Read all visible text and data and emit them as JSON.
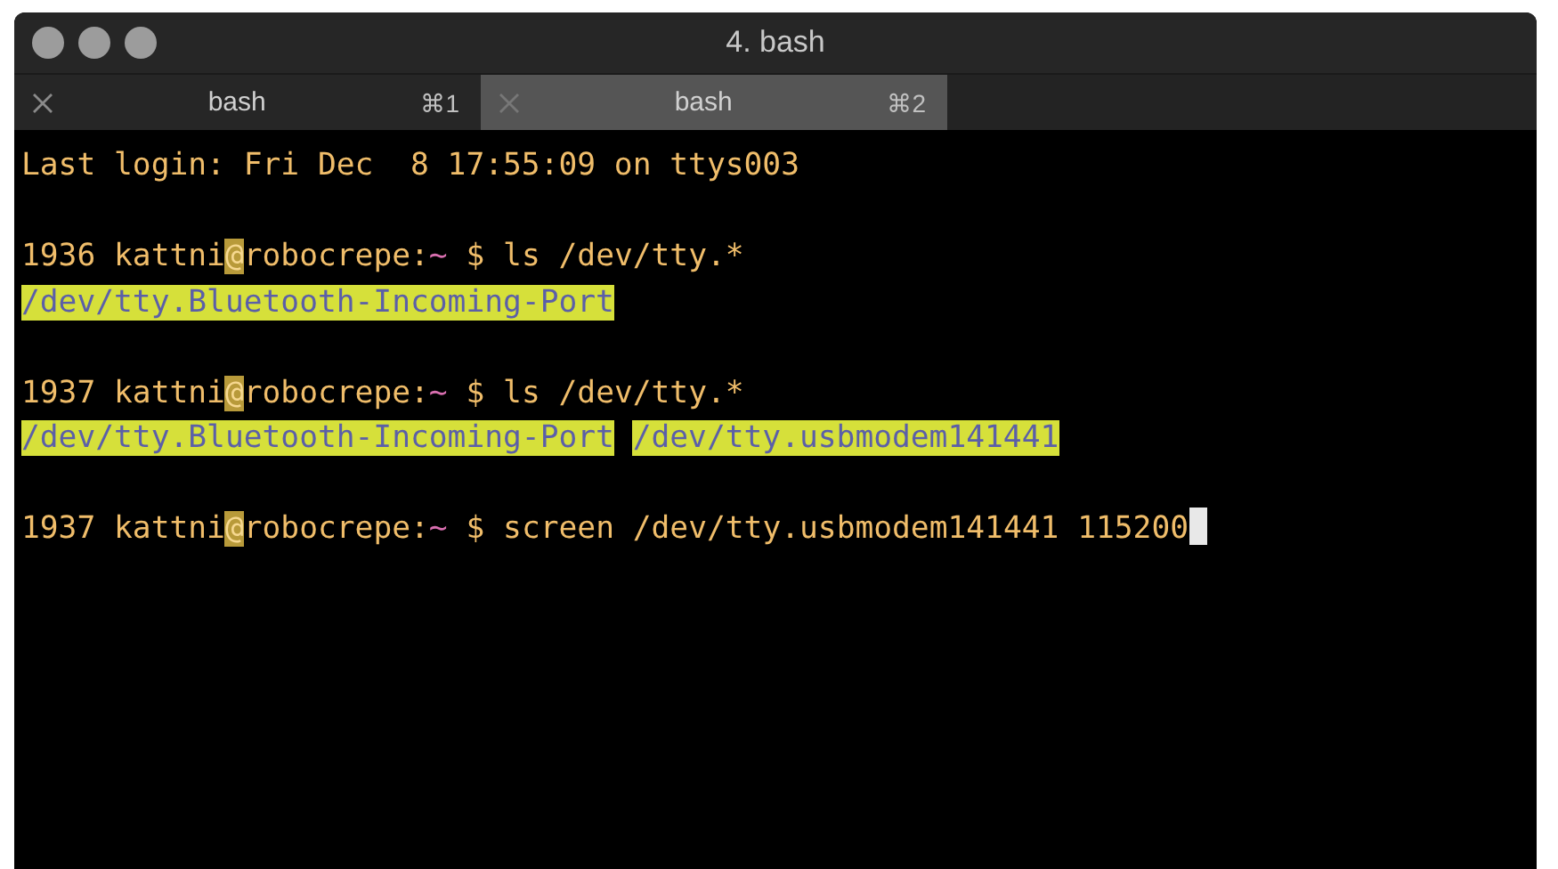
{
  "window": {
    "title": "4. bash"
  },
  "tabs": [
    {
      "label": "bash",
      "shortcut": "⌘1",
      "selected": false
    },
    {
      "label": "bash",
      "shortcut": "⌘2",
      "selected": true
    }
  ],
  "terminal": {
    "lines": [
      {
        "kind": "plain",
        "text": "Last login: Fri Dec  8 17:55:09 on ttys003"
      },
      {
        "kind": "blank"
      },
      {
        "kind": "prompt",
        "number": "1936",
        "user": "kattni",
        "at": "@",
        "host": "robocrepe:",
        "path": "~",
        "command": "$ ls /dev/tty.*",
        "cursor": false
      },
      {
        "kind": "output",
        "items": [
          "/dev/tty.Bluetooth-Incoming-Port"
        ]
      },
      {
        "kind": "blank"
      },
      {
        "kind": "prompt",
        "number": "1937",
        "user": "kattni",
        "at": "@",
        "host": "robocrepe:",
        "path": "~",
        "command": "$ ls /dev/tty.*",
        "cursor": false
      },
      {
        "kind": "output",
        "items": [
          "/dev/tty.Bluetooth-Incoming-Port",
          "/dev/tty.usbmodem141441"
        ]
      },
      {
        "kind": "blank"
      },
      {
        "kind": "prompt",
        "number": "1937",
        "user": "kattni",
        "at": "@",
        "host": "robocrepe:",
        "path": "~",
        "command": "$ screen /dev/tty.usbmodem141441 115200",
        "cursor": true
      }
    ]
  }
}
